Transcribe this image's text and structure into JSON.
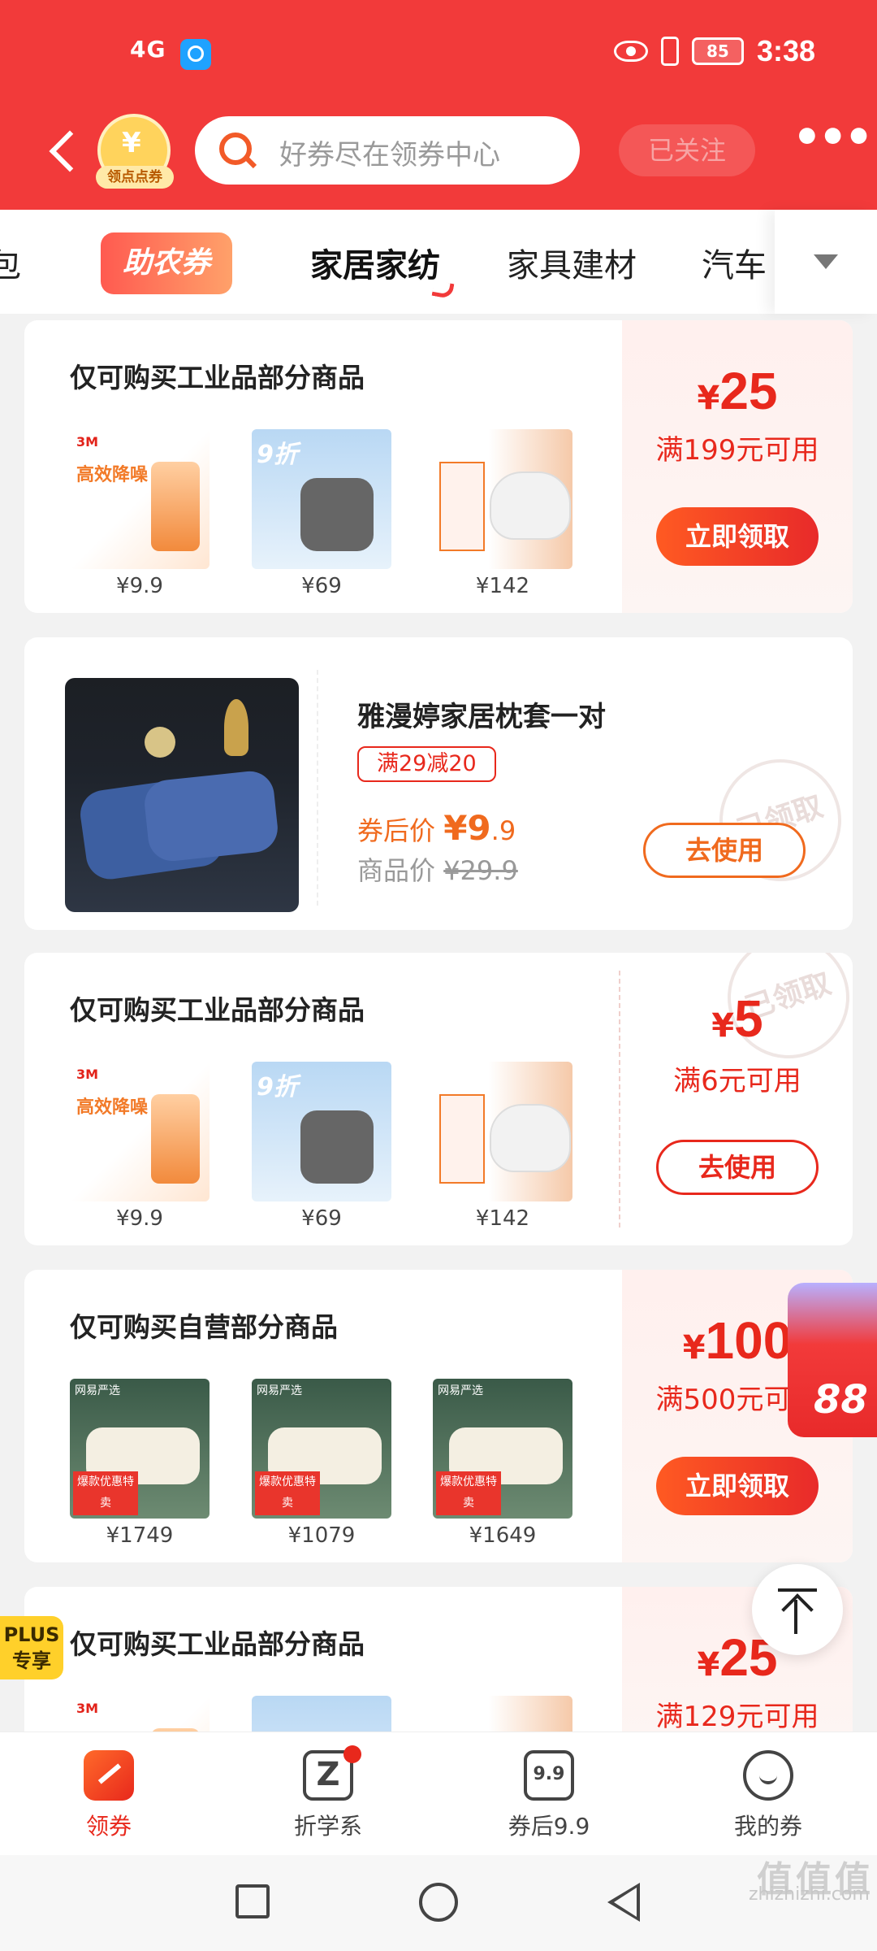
{
  "status_bar": {
    "network": "4G",
    "battery": "85",
    "time": "3:38"
  },
  "header": {
    "coin_label": "领点点券",
    "coin_symbol": "¥",
    "search_placeholder": "好券尽在领券中心",
    "follow_label": "已关注",
    "more_label": "•••"
  },
  "categories": {
    "left_partial": "包",
    "promo": "助农券",
    "items": [
      "家居家纺",
      "家具建材",
      "汽车"
    ],
    "selected": "家居家纺"
  },
  "cards": [
    {
      "title": "仅可购买工业品部分商品",
      "products": [
        {
          "price": "¥9.9",
          "image": "3m-earplugs",
          "image_text": "高效降噪",
          "brand": "3M"
        },
        {
          "price": "¥69",
          "image": "kn95-mask",
          "image_text": "9折"
        },
        {
          "price": "¥142",
          "image": "3m-mask",
          "image_text": ""
        }
      ],
      "amount_symbol": "¥",
      "amount": "25",
      "condition": "满199元可用",
      "button": "立即领取"
    },
    {
      "title": "雅漫婷家居枕套一对",
      "tag": "满29减20",
      "after_label": "券后价",
      "after_symbol": "¥",
      "after_int": "9",
      "after_dec": ".9",
      "orig_label": "商品价",
      "orig_price": "¥29.9",
      "stamp": "已领取",
      "button": "去使用"
    },
    {
      "title": "仅可购买工业品部分商品",
      "products": [
        {
          "price": "¥9.9",
          "image": "3m-earplugs",
          "image_text": "高效降噪",
          "brand": "3M"
        },
        {
          "price": "¥69",
          "image": "kn95-mask",
          "image_text": "9折"
        },
        {
          "price": "¥142",
          "image": "3m-mask",
          "image_text": ""
        }
      ],
      "amount_symbol": "¥",
      "amount": "5",
      "condition": "满6元可用",
      "stamp": "已领取",
      "button": "去使用"
    },
    {
      "title": "仅可购买自营部分商品",
      "products": [
        {
          "price": "¥1749",
          "image": "latex-pillow",
          "brand": "网易严选",
          "image_text": "爆款优惠特卖"
        },
        {
          "price": "¥1079",
          "image": "latex-pillow",
          "brand": "网易严选",
          "image_text": "爆款优惠特卖"
        },
        {
          "price": "¥1649",
          "image": "latex-pillow",
          "brand": "网易严选",
          "image_text": "爆款优惠特卖"
        }
      ],
      "amount_symbol": "¥",
      "amount": "100",
      "condition": "满500元可用",
      "button": "立即领取"
    },
    {
      "title": "仅可购买工业品部分商品",
      "amount_symbol": "¥",
      "amount": "25",
      "condition": "满129元可用"
    }
  ],
  "floating": {
    "red_packet_text": "88",
    "plus_badge": "PLUS专享"
  },
  "bottom_nav": [
    {
      "label": "领券",
      "icon": "coupon-icon",
      "active": true
    },
    {
      "label": "折学系",
      "icon": "z-icon",
      "badge": true
    },
    {
      "label": "券后9.9",
      "icon": "price-99-icon",
      "icon_text": "9.9"
    },
    {
      "label": "我的券",
      "icon": "my-coupon-icon"
    }
  ],
  "watermark": {
    "logo": "值值值",
    "url": "zhizhizhi.com"
  },
  "colors": {
    "primary": "#f23a3a",
    "accent": "#e8281c",
    "orange": "#f06a1e"
  }
}
